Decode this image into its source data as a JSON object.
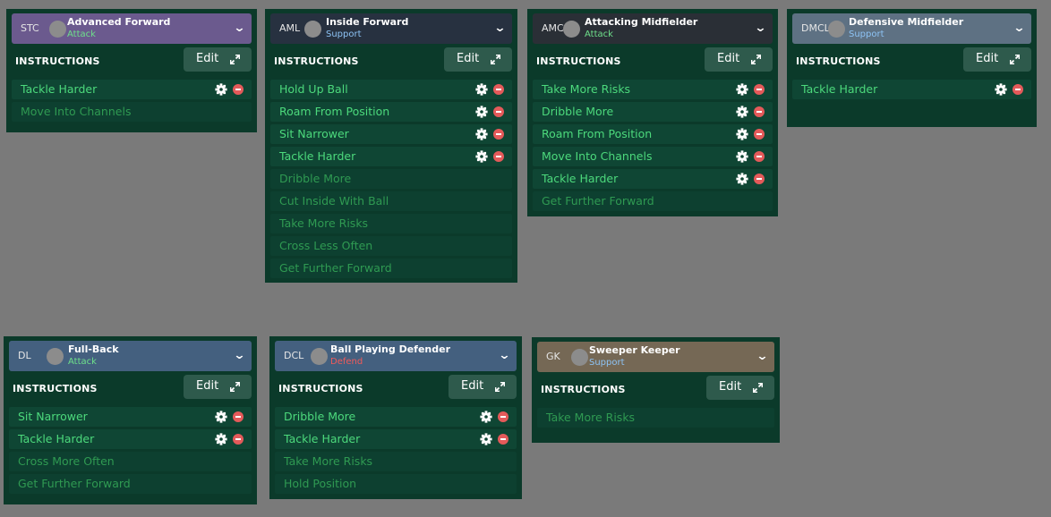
{
  "colors": {
    "attack": "#6ee08b",
    "support": "#8dc3f5",
    "defend": "#f05a5a"
  },
  "common": {
    "instructions_title": "INSTRUCTIONS",
    "edit_label": "Edit",
    "expand_icon": "expand-icon",
    "gear_icon": "gear-icon",
    "remove_icon": "remove-icon",
    "chevron_icon": "chevron-down-icon"
  },
  "panels": [
    {
      "code": "STC",
      "role": "Advanced Forward",
      "duty": "Attack",
      "header_color": "#6b5a8e",
      "active": [
        "Tackle Harder"
      ],
      "suggested": [
        "Move Into Channels"
      ]
    },
    {
      "code": "AML",
      "role": "Inside Forward",
      "duty": "Support",
      "header_color": "#273140",
      "active": [
        "Hold Up Ball",
        "Roam From Position",
        "Sit Narrower",
        "Tackle Harder"
      ],
      "suggested": [
        "Dribble More",
        "Cut Inside With Ball",
        "Take More Risks",
        "Cross Less Often",
        "Get Further Forward"
      ]
    },
    {
      "code": "AMC",
      "role": "Attacking Midfielder",
      "duty": "Attack",
      "header_color": "#2a2f36",
      "active": [
        "Take More Risks",
        "Dribble More",
        "Roam From Position",
        "Move Into Channels",
        "Tackle Harder"
      ],
      "suggested": [
        "Get Further Forward"
      ]
    },
    {
      "code": "DMCL",
      "role": "Defensive Midfielder",
      "duty": "Support",
      "header_color": "#5e7183",
      "active": [
        "Tackle Harder"
      ],
      "suggested": []
    },
    {
      "code": "DL",
      "role": "Full-Back",
      "duty": "Attack",
      "header_color": "#44607f",
      "active": [
        "Sit Narrower",
        "Tackle Harder"
      ],
      "suggested": [
        "Cross More Often",
        "Get Further Forward"
      ]
    },
    {
      "code": "DCL",
      "role": "Ball Playing Defender",
      "duty": "Defend",
      "header_color": "#44607f",
      "active": [
        "Dribble More",
        "Tackle Harder"
      ],
      "suggested": [
        "Take More Risks",
        "Hold Position"
      ]
    },
    {
      "code": "GK",
      "role": "Sweeper Keeper",
      "duty": "Support",
      "header_color": "#756855",
      "active": [],
      "suggested": [
        "Take More Risks"
      ]
    }
  ]
}
